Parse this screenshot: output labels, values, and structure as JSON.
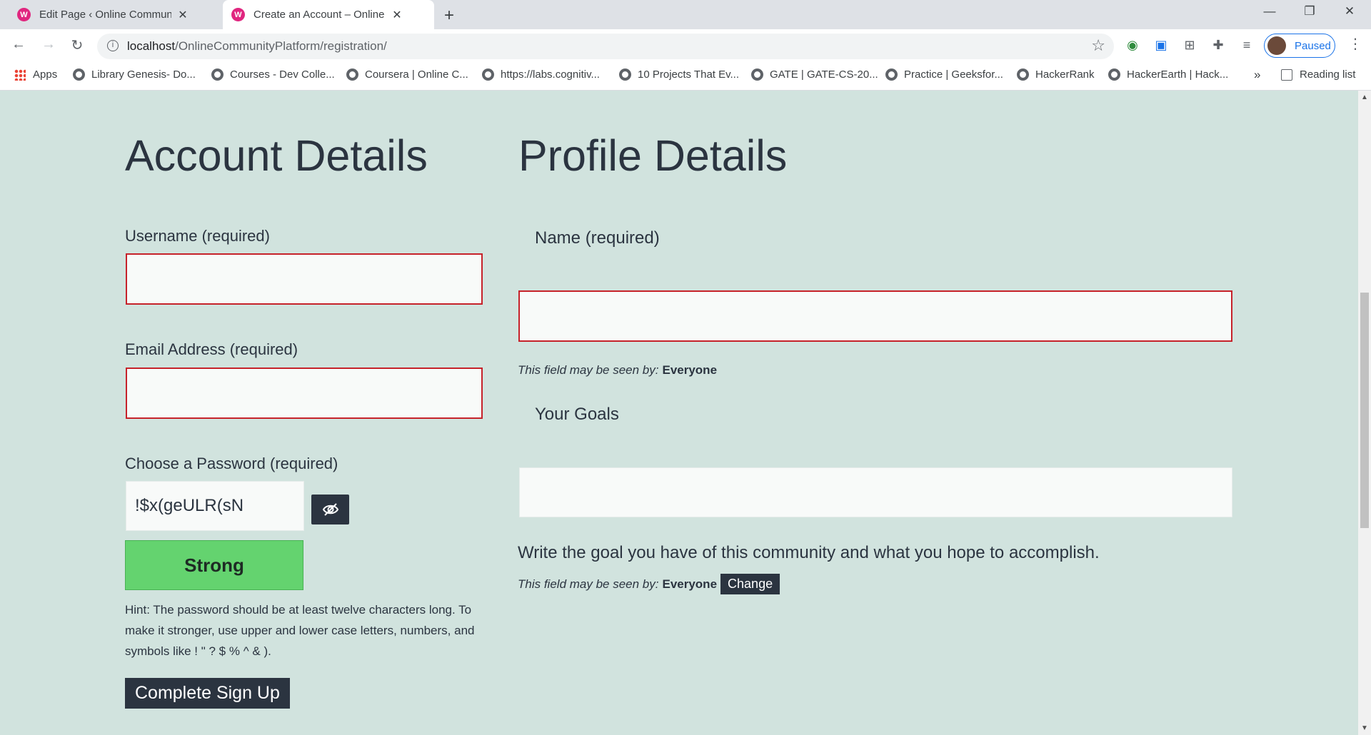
{
  "browser": {
    "tabs": [
      {
        "label": "Edit Page ‹ Online Community Platform",
        "favicon": "W"
      },
      {
        "label": "Create an Account – Online Community Platform",
        "favicon": "W"
      }
    ],
    "url_host": "localhost",
    "url_path": "/OnlineCommunityPlatform/registration/",
    "profile_status": "Paused",
    "bookmarks": [
      {
        "label": "Apps"
      },
      {
        "label": "Library Genesis- Do..."
      },
      {
        "label": "Courses - Dev Colle..."
      },
      {
        "label": "Coursera | Online C..."
      },
      {
        "label": "https://labs.cognitiv..."
      },
      {
        "label": "10 Projects That Ev..."
      },
      {
        "label": "GATE | GATE-CS-20..."
      },
      {
        "label": "Practice | Geeksfor..."
      },
      {
        "label": "HackerRank"
      },
      {
        "label": "HackerEarth | Hack..."
      }
    ],
    "bookmarks_more": "»",
    "reading_list": "Reading list"
  },
  "account": {
    "heading": "Account Details",
    "username_label": "Username (required)",
    "username_value": "",
    "email_label": "Email Address (required)",
    "email_value": "",
    "password_label": "Choose a Password (required)",
    "password_value": "!$x(geULR(sN",
    "strength": "Strong",
    "hint": "Hint: The password should be at least twelve characters long. To make it stronger, use upper and lower case letters, numbers, and symbols like ! \" ? $ % ^ & ).",
    "submit_label": "Complete Sign Up"
  },
  "profile": {
    "heading": "Profile Details",
    "name_label": "Name (required)",
    "name_value": "",
    "visibility_prefix": "This field may be seen by:",
    "visibility_value": "Everyone",
    "goals_label": "Your Goals",
    "goals_value": "",
    "goals_description": "Write the goal you have of this community and what you hope to accomplish.",
    "change_label": "Change"
  },
  "colors": {
    "page_bg": "#d1e3de",
    "error_border": "#c6222a",
    "strength_strong": "#64d36f",
    "dark_button": "#2b3440"
  }
}
